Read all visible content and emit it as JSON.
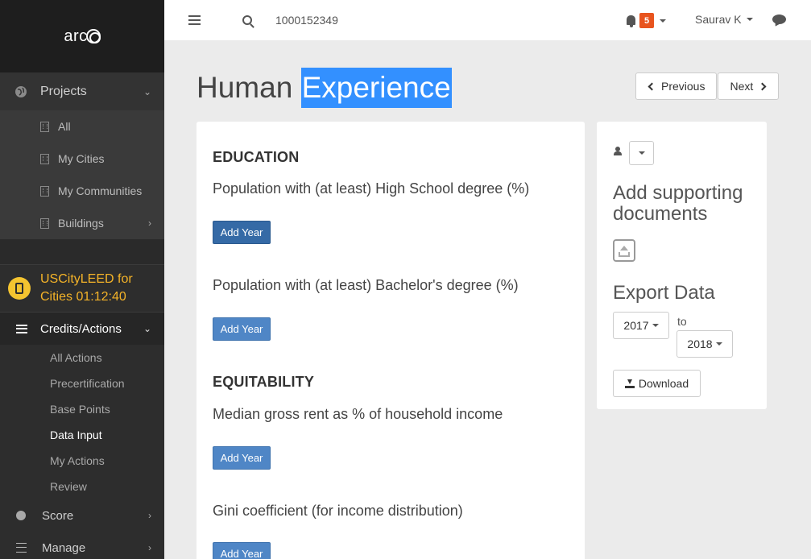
{
  "logo": {
    "text": "arc"
  },
  "sidebar": {
    "projects_label": "Projects",
    "project_items": [
      {
        "label": "All"
      },
      {
        "label": "My Cities"
      },
      {
        "label": "My Communities"
      },
      {
        "label": "Buildings"
      }
    ],
    "timer_line1": "USCityLEED for",
    "timer_line2": "Cities 01:12:40",
    "credits_label": "Credits/Actions",
    "credit_items": [
      {
        "label": "All Actions"
      },
      {
        "label": "Precertification"
      },
      {
        "label": "Base Points"
      },
      {
        "label": "Data Input"
      },
      {
        "label": "My Actions"
      },
      {
        "label": "Review"
      }
    ],
    "score_label": "Score",
    "manage_label": "Manage"
  },
  "topbar": {
    "search_value": "1000152349",
    "notification_count": "5",
    "user_name": "Saurav K"
  },
  "page": {
    "title_part1": "Human",
    "title_part2": "Experience",
    "prev_label": "Previous",
    "next_label": "Next"
  },
  "sections": {
    "education_title": "EDUCATION",
    "education_q1": "Population with (at least) High School degree (%)",
    "education_q2": "Population with (at least) Bachelor's degree (%)",
    "equitability_title": "EQUITABILITY",
    "equitability_q1": "Median gross rent as % of household income",
    "equitability_q2": "Gini coefficient (for income distribution)",
    "add_year_label": "Add Year"
  },
  "side": {
    "supporting_line1": "Add supporting",
    "supporting_line2": "documents",
    "export_title": "Export Data",
    "from_year": "2017",
    "to_label": "to",
    "to_year": "2018",
    "download_label": "Download"
  }
}
